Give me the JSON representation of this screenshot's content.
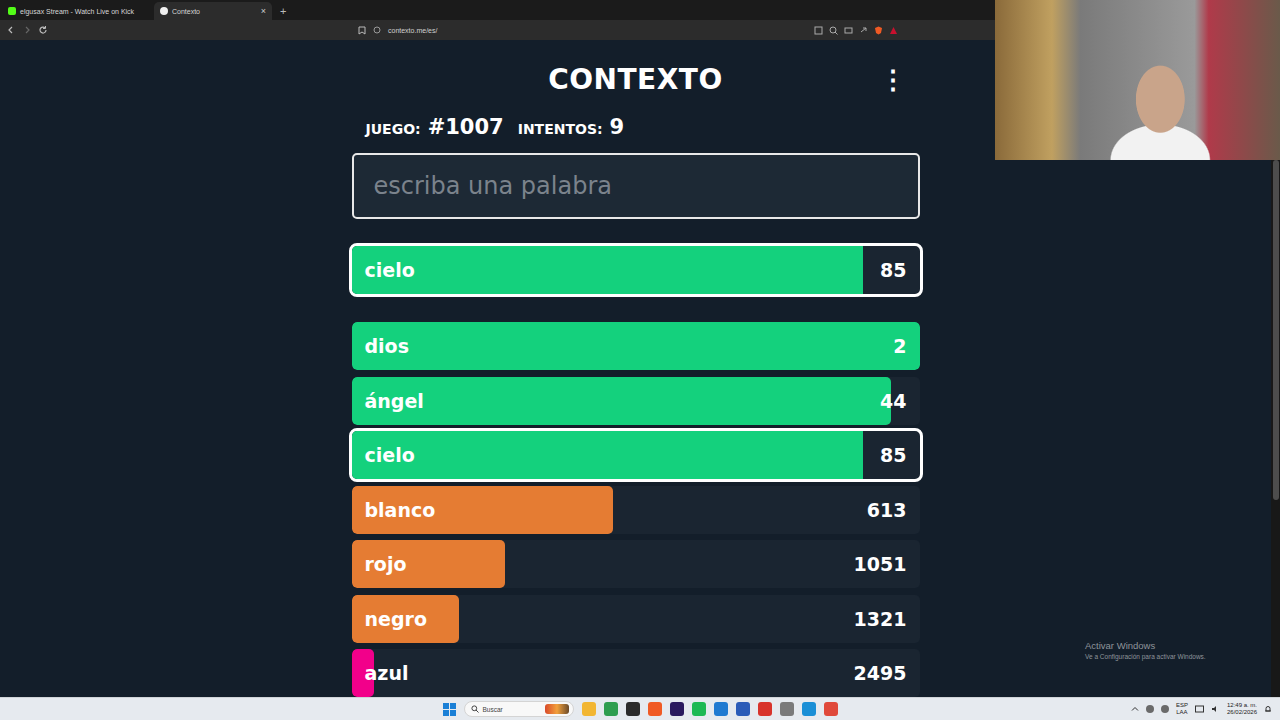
{
  "browser": {
    "tabs": [
      {
        "label": "elgusax Stream - Watch Live on Kick",
        "selected": false,
        "close": ""
      },
      {
        "label": "Contexto",
        "selected": true,
        "close": "×"
      }
    ],
    "new_tab": "+",
    "url": "contexto.me/es/"
  },
  "game": {
    "title": "CONTEXTO",
    "menu": "⋮",
    "game_label": "JUEGO:",
    "game_number": "#1007",
    "attempts_label": "INTENTOS:",
    "attempts": "9",
    "input_placeholder": "escriba una palabra",
    "last_guess": {
      "word": "cielo",
      "rank": "85",
      "level": 0.9,
      "color": "#14d17d",
      "highlighted": true
    },
    "guesses": [
      {
        "word": "dios",
        "rank": "2",
        "level": 1.0,
        "color": "#14d17d",
        "highlighted": false
      },
      {
        "word": "ángel",
        "rank": "44",
        "level": 0.95,
        "color": "#14d17d",
        "highlighted": false
      },
      {
        "word": "cielo",
        "rank": "85",
        "level": 0.9,
        "color": "#14d17d",
        "highlighted": true
      },
      {
        "word": "blanco",
        "rank": "613",
        "level": 0.46,
        "color": "#e57c33",
        "highlighted": false
      },
      {
        "word": "rojo",
        "rank": "1051",
        "level": 0.27,
        "color": "#e57c33",
        "highlighted": false
      },
      {
        "word": "negro",
        "rank": "1321",
        "level": 0.19,
        "color": "#e57c33",
        "highlighted": false
      },
      {
        "word": "azul",
        "rank": "2495",
        "level": 0.04,
        "color": "#f2008a",
        "highlighted": false
      }
    ]
  },
  "watermark": {
    "title": "Activar Windows",
    "subtitle": "Ve a Configuración para activar Windows."
  },
  "taskbar": {
    "search_placeholder": "Buscar",
    "language": [
      "ESP",
      "LAA"
    ],
    "time": "12:49 a. m.",
    "date": "26/02/2026"
  }
}
